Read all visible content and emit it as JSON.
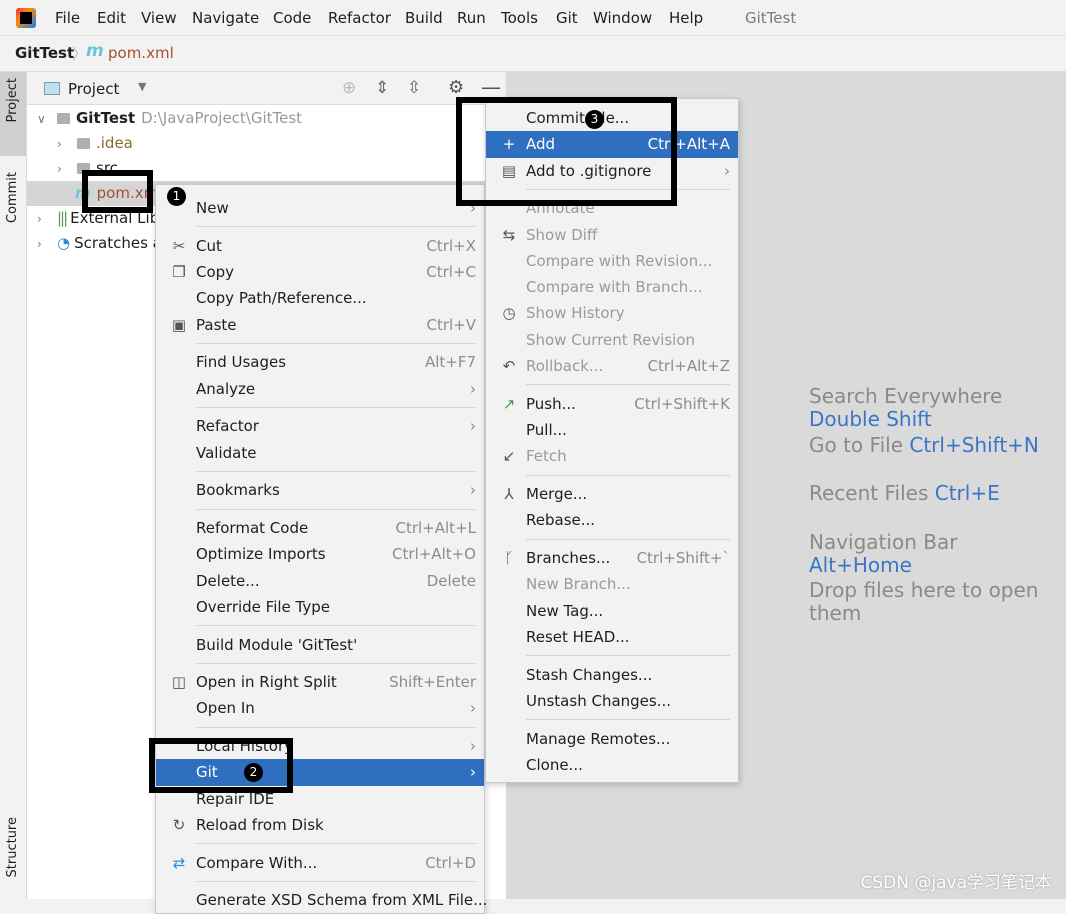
{
  "app": {
    "title": "GitTest"
  },
  "menubar": [
    "File",
    "Edit",
    "View",
    "Navigate",
    "Code",
    "Refactor",
    "Build",
    "Run",
    "Tools",
    "Git",
    "Window",
    "Help"
  ],
  "breadcrumb": {
    "project": "GitTest",
    "file": "pom.xml"
  },
  "stripe": {
    "project": "Project",
    "commit": "Commit",
    "structure": "Structure"
  },
  "panel": {
    "title": "Project"
  },
  "tree": [
    {
      "label": "GitTest",
      "path": "D:\\JavaProject\\GitTest"
    },
    {
      "label": ".idea"
    },
    {
      "label": "src"
    },
    {
      "label": "pom.xml",
      "selected": true
    },
    {
      "label": "External Libraries"
    },
    {
      "label": "Scratches and Consoles"
    }
  ],
  "context_menu": [
    {
      "label": "New",
      "submenu": true
    },
    {
      "sep": true
    },
    {
      "label": "Cut",
      "shortcut": "Ctrl+X",
      "icon": "scissors-icon"
    },
    {
      "label": "Copy",
      "shortcut": "Ctrl+C",
      "icon": "copy-icon"
    },
    {
      "label": "Copy Path/Reference..."
    },
    {
      "label": "Paste",
      "shortcut": "Ctrl+V",
      "icon": "paste-icon"
    },
    {
      "sep": true
    },
    {
      "label": "Find Usages",
      "shortcut": "Alt+F7"
    },
    {
      "label": "Analyze",
      "submenu": true
    },
    {
      "sep": true
    },
    {
      "label": "Refactor",
      "submenu": true
    },
    {
      "label": "Validate"
    },
    {
      "sep": true
    },
    {
      "label": "Bookmarks",
      "submenu": true
    },
    {
      "sep": true
    },
    {
      "label": "Reformat Code",
      "shortcut": "Ctrl+Alt+L"
    },
    {
      "label": "Optimize Imports",
      "shortcut": "Ctrl+Alt+O"
    },
    {
      "label": "Delete...",
      "shortcut": "Delete"
    },
    {
      "label": "Override File Type"
    },
    {
      "sep": true
    },
    {
      "label": "Build Module 'GitTest'"
    },
    {
      "sep": true
    },
    {
      "label": "Open in Right Split",
      "shortcut": "Shift+Enter",
      "icon": "split-icon"
    },
    {
      "label": "Open In",
      "submenu": true
    },
    {
      "sep": true
    },
    {
      "label": "Local History",
      "submenu": true
    },
    {
      "label": "Git",
      "submenu": true,
      "highlighted": true
    },
    {
      "label": "Repair IDE"
    },
    {
      "label": "Reload from Disk",
      "icon": "reload-icon"
    },
    {
      "sep": true
    },
    {
      "label": "Compare With...",
      "shortcut": "Ctrl+D",
      "icon": "compare-icon"
    },
    {
      "sep": true
    },
    {
      "label": "Generate XSD Schema from XML File..."
    }
  ],
  "git_submenu": [
    {
      "label": "Commit File..."
    },
    {
      "label": "Add",
      "shortcut": "Ctrl+Alt+A",
      "icon": "plus-icon",
      "highlighted": true
    },
    {
      "label": "Add to .gitignore",
      "submenu": true,
      "icon": "gitignore-icon"
    },
    {
      "sep": true
    },
    {
      "label": "Annotate",
      "disabled": true
    },
    {
      "label": "Show Diff",
      "disabled": true,
      "icon": "diff-icon"
    },
    {
      "label": "Compare with Revision...",
      "disabled": true
    },
    {
      "label": "Compare with Branch...",
      "disabled": true
    },
    {
      "label": "Show History",
      "disabled": true,
      "icon": "history-icon"
    },
    {
      "label": "Show Current Revision",
      "disabled": true
    },
    {
      "label": "Rollback...",
      "shortcut": "Ctrl+Alt+Z",
      "disabled": true,
      "icon": "rollback-icon"
    },
    {
      "sep": true
    },
    {
      "label": "Push...",
      "shortcut": "Ctrl+Shift+K",
      "icon": "push-icon"
    },
    {
      "label": "Pull..."
    },
    {
      "label": "Fetch",
      "disabled": true,
      "icon": "fetch-icon"
    },
    {
      "sep": true
    },
    {
      "label": "Merge...",
      "icon": "merge-icon"
    },
    {
      "label": "Rebase..."
    },
    {
      "sep": true
    },
    {
      "label": "Branches...",
      "shortcut": "Ctrl+Shift+`",
      "icon": "branch-icon"
    },
    {
      "label": "New Branch...",
      "disabled": true
    },
    {
      "label": "New Tag..."
    },
    {
      "label": "Reset HEAD..."
    },
    {
      "sep": true
    },
    {
      "label": "Stash Changes..."
    },
    {
      "label": "Unstash Changes..."
    },
    {
      "sep": true
    },
    {
      "label": "Manage Remotes..."
    },
    {
      "label": "Clone..."
    }
  ],
  "editor_hints": [
    {
      "text": "Search Everywhere",
      "key": "Double Shift"
    },
    {
      "text": "Go to File",
      "key": "Ctrl+Shift+N"
    },
    {
      "text": "Recent Files",
      "key": "Ctrl+E"
    },
    {
      "text": "Navigation Bar",
      "key": "Alt+Home"
    },
    {
      "text": "Drop files here to open them",
      "key": ""
    }
  ],
  "annotations": [
    "1",
    "2",
    "3"
  ],
  "watermark": "CSDN @java学习笔记本",
  "colors": {
    "highlight": "#2f6fbf",
    "shortcut_blue": "#3b76c6",
    "editor_bg": "#dadada"
  }
}
